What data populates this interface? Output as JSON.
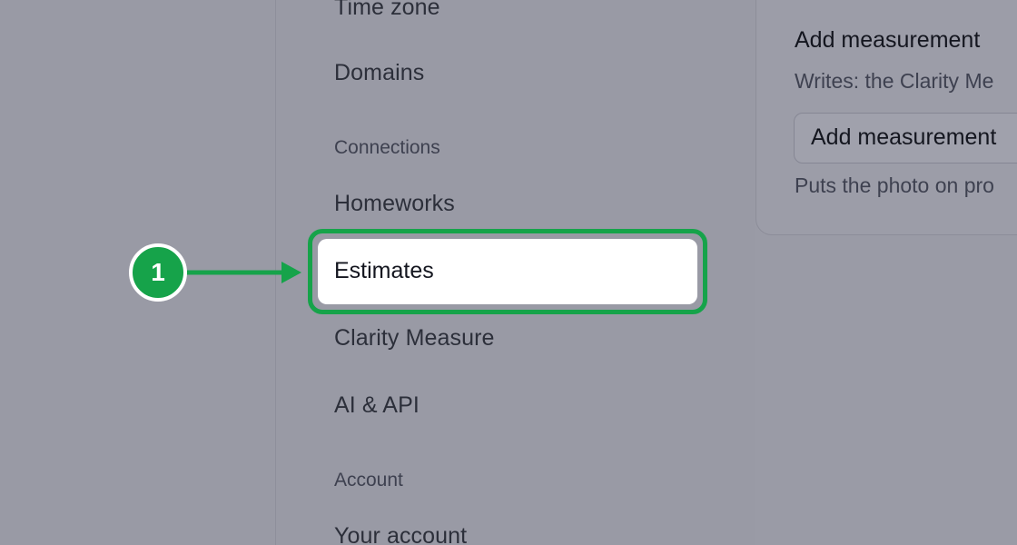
{
  "sidebar": {
    "items": [
      {
        "label": "Time zone"
      },
      {
        "label": "Domains"
      },
      {
        "label": "Homeworks"
      },
      {
        "label": "Estimates"
      },
      {
        "label": "Clarity Measure"
      },
      {
        "label": "AI & API"
      },
      {
        "label": "Your account"
      }
    ],
    "sections": {
      "connections": "Connections",
      "account": "Account"
    },
    "active_item": "Estimates"
  },
  "callout": {
    "step_number": "1",
    "color": "#16a34a"
  },
  "card": {
    "title": "Add measurement",
    "description": "Writes: the Clarity Me",
    "button_label": "Add measurement",
    "hint": "Puts the photo on pro"
  },
  "colors": {
    "overlay": "#9a9ba6",
    "highlight": "#16a34a",
    "active_bg": "#ffffff"
  }
}
